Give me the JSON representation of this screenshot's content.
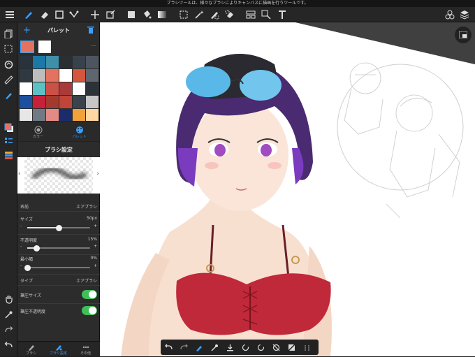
{
  "tip": "ブラシツールは、様々なブラシによりキャンバスに描画を行うツールです。",
  "panel": {
    "title": "パレット",
    "more_label": "---",
    "tabs": [
      {
        "label": "カラー"
      },
      {
        "label": "パレット"
      }
    ],
    "brush_section_title": "ブラシ設定",
    "palette_colors": [
      "#28333b",
      "#1b79a8",
      "#3f8fa8",
      "#2a2f33",
      "#39424a",
      "#4d5560",
      "#2f3942",
      "#bdbdbd",
      "#e3735e",
      "#ffffff",
      "#d4563d",
      "#5e6770",
      "#ffffff",
      "#5cc1c5",
      "#cb5147",
      "#a83a3a",
      "#ffffff",
      "#2b3238",
      "#1d4fa0",
      "#c8203b",
      "#a23a2e",
      "#bf443a",
      "#3a434b",
      "#c7c7c7",
      "#e7e7e7",
      "#6f7a84",
      "#e48a84",
      "#1a2c6b",
      "#f2a23a",
      "#ffd7a3",
      "#cfe9ef",
      "#fbd0c9",
      "#53b5e8",
      "#3c6fbf",
      "#f3a75a",
      "#7fb3df"
    ],
    "settings": {
      "name_label": "名前",
      "name_value": "エアブラシ",
      "size_label": "サイズ",
      "size_value": "50px",
      "size_fraction": 0.5,
      "opacity_label": "不透明度",
      "opacity_value": "15%",
      "opacity_fraction": 0.15,
      "min_width_label": "最小幅",
      "min_width_value": "0%",
      "min_width_fraction": 0.0,
      "type_label": "タイプ",
      "type_value": "エアブラシ",
      "pressure_size_label": "筆圧サイズ",
      "pressure_opacity_label": "筆圧不透明度"
    },
    "bottom_tabs": [
      {
        "label": "ブラシ"
      },
      {
        "label": "ブラシ設定"
      },
      {
        "label": "その他"
      }
    ]
  },
  "icons": {
    "top": [
      "menu-icon",
      "brush-icon",
      "eraser-icon",
      "rectangle-icon",
      "lasso-icon",
      "move-icon",
      "transform-icon",
      "fill-rect-icon",
      "bucket-icon",
      "gradient-icon",
      "selection-icon",
      "magic-wand-icon",
      "select-pen-icon",
      "select-eraser-icon",
      "frame-icon",
      "text-select-icon",
      "text-icon",
      "materials-icon",
      "layers-icon"
    ]
  }
}
